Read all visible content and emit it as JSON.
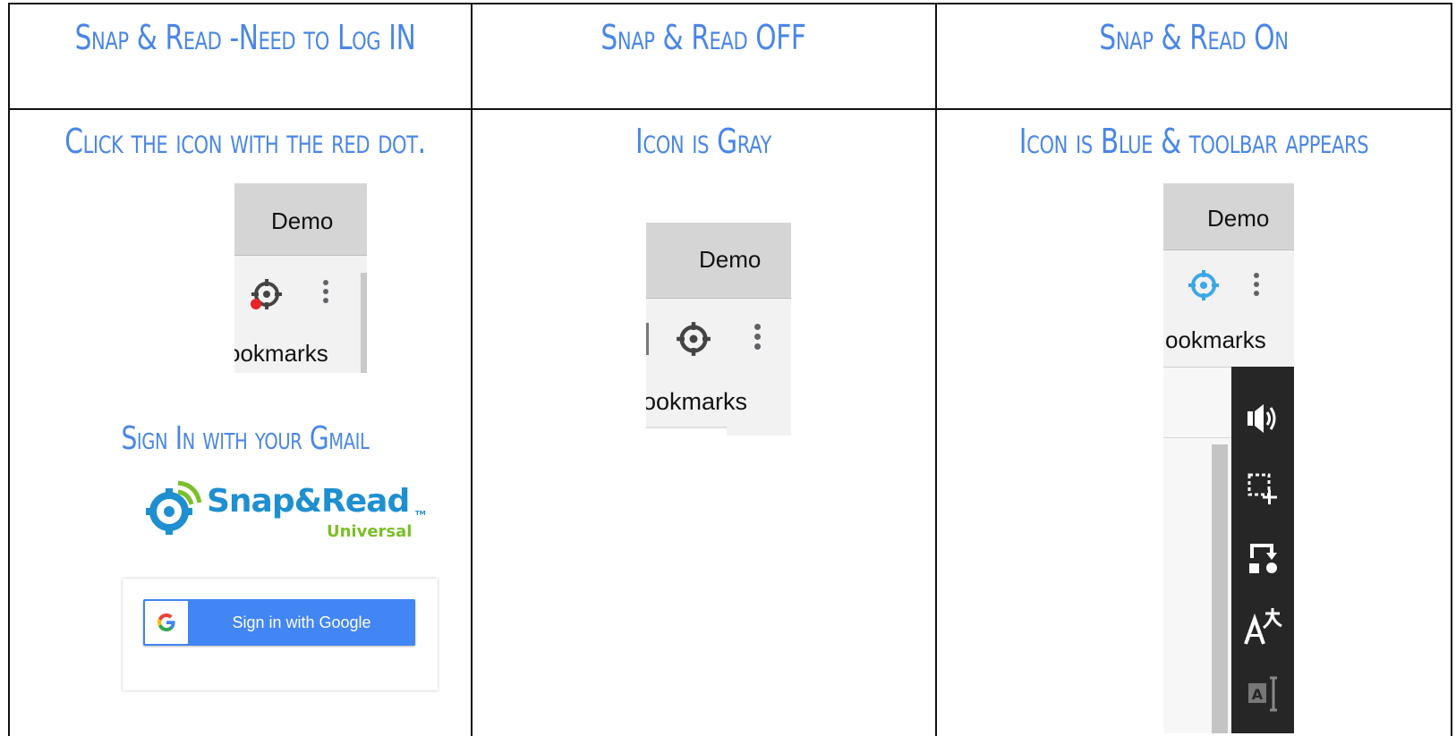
{
  "columns": [
    {
      "title": "Snap & Read -Need to Log IN",
      "subtitle": "Click the icon with the red dot.",
      "crop": {
        "tab_label": "Demo",
        "bookmarks_label": "ookmarks"
      },
      "signin_heading": "Sign In with your Gmail",
      "logo": {
        "brand": "Snap&Read",
        "tm": "TM",
        "subbrand": "Universal"
      },
      "google_button_label": "Sign in with Google"
    },
    {
      "title": "Snap & Read OFF",
      "subtitle": "Icon is Gray",
      "crop": {
        "tab_label": "Demo",
        "bookmarks_label": "ookmarks"
      }
    },
    {
      "title": "Snap & Read On",
      "subtitle": "Icon is Blue & toolbar appears",
      "crop": {
        "tab_label": "Demo",
        "bookmarks_label": "ookmarks"
      }
    }
  ],
  "icons": {
    "extension_icon": "crosshair-target-icon",
    "notification_dot": "red-dot-icon",
    "menu": "three-dots-vertical-icon",
    "toolbar_tools": [
      "speaker-icon",
      "screen-select-icon",
      "reading-order-icon",
      "translate-icon",
      "text-select-icon"
    ]
  },
  "colors": {
    "heading": "#4a86e8",
    "icon_gray": "#444444",
    "icon_blue": "#3ba7e6",
    "red_dot": "#e8232a",
    "toolbar_bg": "#262626",
    "google_blue": "#4285f4",
    "logo_blue": "#1e8fd0",
    "logo_green": "#7bbf2a"
  }
}
